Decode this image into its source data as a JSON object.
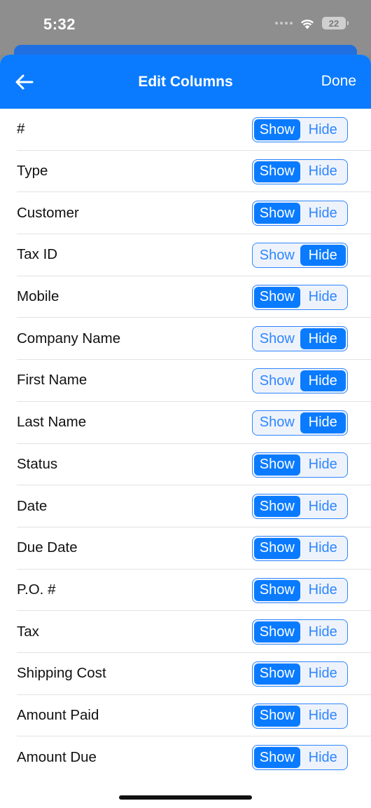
{
  "status_bar": {
    "time": "5:32",
    "battery": "22"
  },
  "nav": {
    "title": "Edit Columns",
    "done_label": "Done"
  },
  "colors": {
    "accent": "#0a7bff",
    "selected_text": "#ffffff",
    "segment_border": "#2f86ff"
  },
  "icons": {
    "back": "arrow-left-icon",
    "wifi": "wifi-icon",
    "battery": "battery-icon"
  },
  "segment_labels": {
    "show": "Show",
    "hide": "Hide"
  },
  "columns": [
    {
      "label": "#",
      "state": "Show"
    },
    {
      "label": "Type",
      "state": "Show"
    },
    {
      "label": "Customer",
      "state": "Show"
    },
    {
      "label": "Tax ID",
      "state": "Hide"
    },
    {
      "label": "Mobile",
      "state": "Show"
    },
    {
      "label": "Company Name",
      "state": "Hide"
    },
    {
      "label": "First Name",
      "state": "Hide"
    },
    {
      "label": "Last Name",
      "state": "Hide"
    },
    {
      "label": "Status",
      "state": "Show"
    },
    {
      "label": "Date",
      "state": "Show"
    },
    {
      "label": "Due Date",
      "state": "Show"
    },
    {
      "label": "P.O. #",
      "state": "Show"
    },
    {
      "label": "Tax",
      "state": "Show"
    },
    {
      "label": "Shipping Cost",
      "state": "Show"
    },
    {
      "label": "Amount Paid",
      "state": "Show"
    },
    {
      "label": "Amount Due",
      "state": "Show"
    }
  ]
}
